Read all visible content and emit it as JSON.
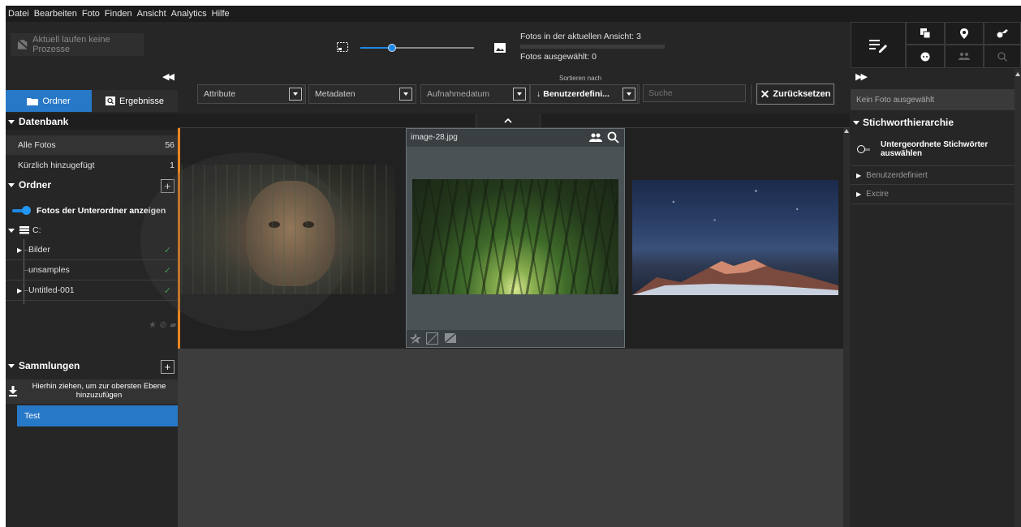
{
  "menu": [
    "Datei",
    "Bearbeiten",
    "Foto",
    "Finden",
    "Ansicht",
    "Analytics",
    "Hilfe"
  ],
  "topbar": {
    "process_text": "Aktuell laufen keine Prozesse",
    "photos_in_view": "Fotos in der aktuellen Ansicht: 3",
    "photos_selected": "Fotos ausgewählt: 0"
  },
  "sidebar": {
    "tabs": {
      "folders": "Ordner",
      "results": "Ergebnisse"
    },
    "database": {
      "title": "Datenbank",
      "all_photos": {
        "label": "Alle Fotos",
        "count": "56"
      },
      "recent": {
        "label": "Kürzlich hinzugefügt",
        "count": "1"
      }
    },
    "folders": {
      "title": "Ordner",
      "subfolder_toggle": "Fotos der Unterordner anzeigen",
      "drive": "C:",
      "items": [
        "Bilder",
        "unsamples",
        "Untitled-001"
      ]
    },
    "collections": {
      "title": "Sammlungen",
      "drop_hint": "Hierhin ziehen, um zur obersten Ebene hinzuzufügen",
      "items": [
        "Test"
      ]
    }
  },
  "filters": {
    "attributes": "Attribute",
    "metadata": "Metadaten",
    "capture_date": "Aufnahmedatum",
    "sort_label": "Sortieren nach",
    "sort_value": "Benutzerdefini...",
    "search_placeholder": "Suche",
    "reset": "Zurücksetzen"
  },
  "grid": {
    "photos": [
      {
        "name": ""
      },
      {
        "name": "image-28.jpg"
      },
      {
        "name": ""
      }
    ]
  },
  "right": {
    "no_photo": "Kein Foto ausgewählt",
    "keyword_title": "Stichworthierarchie",
    "child_keywords": "Untergeordnete Stichwörter auswählen",
    "custom": "Benutzerdefiniert",
    "excire": "Excire"
  },
  "colors": {
    "accent": "#1e88e5",
    "selected_bg": "#2878c8",
    "orange": "#e88522",
    "check": "#4caf50"
  }
}
